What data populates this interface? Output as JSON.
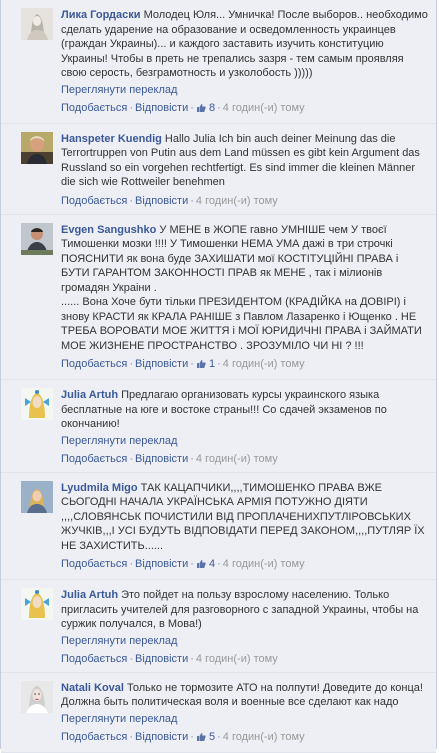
{
  "ui": {
    "translate": "Переглянути переклад",
    "like": "Подобається",
    "reply": "Відповісти",
    "sep": "·"
  },
  "comments": [
    {
      "author": "Лика Гордаски",
      "text": "Молодец Юля... Умничка! После выборов.. необходимо сделать ударение на образование и осведомленность украинцев (граждан Украины)... и каждого заставить изучить конституцию Украины! Чтобы в преть не трепались зазря - тем самым проявляя свою серость, безграмотность и узколобость )))))",
      "translate": "Переглянути переклад",
      "likes": "8",
      "time": "4 годин(-и) тому",
      "avatar": "woman-sketch"
    },
    {
      "author": "Hanspeter Kuendig",
      "text": "Hallo Julia Ich bin auch deiner Meinung das die Terrortruppen von Putin aus dem Land müssen es gibt kein Argument das Russland so ein vorgehen rechtfertigt. Es sind immer die kleinen Männer die sich wie Rottweiler benehmen",
      "translate": "",
      "likes": "",
      "time": "4 годин(-и) тому",
      "avatar": "man-photo"
    },
    {
      "author": "Evgen Sangushko",
      "text": "У МЕНЕ в ЖОПЕ гавно УМНІШЕ чем У твоєї Тимошенки мозки !!!! У Тимошенки НЕМА УМА дажі в три строчкі ПОЯСНИТИ як вона буде ЗАХИШАТИ мої КОСТІТУЦІЙНІ ПРАВА і БУТИ ГАРАНТОМ ЗАКОННОСТІ ПРАВ як МЕНЕ , так і мілионів громадян Украіни .\n...... Вона Хоче бути тільки ПРЕЗИДЕНТОМ (КРАДІЙКА на ДОВІРІ) і знову КРАСТИ як КРАЛА РАНІШЕ з Павлом Лазаренко і Ющенко . НЕ ТРЕБА ВОРОВАТИ МОЕ ЖИТТЯ і МОЇ ЮРИДИЧНІ ПРАВА і ЗАЙМАТИ МОЕ ЖИЗНЕНЕ ПРОСТРАНСТВО . ЗРОЗУМІЛО ЧИ НІ ? !!!",
      "translate": "",
      "likes": "1",
      "time": "4 годин(-и) тому",
      "avatar": "man-photo-2"
    },
    {
      "author": "Julia Artuh",
      "text": "Предлагаю организовать курсы украинского языка бесплатные на юге и востоке страны!!! Со сдачей экзаменов по окончанию!",
      "translate": "Переглянути переклад",
      "likes": "",
      "time": "4 годин(-и) тому",
      "avatar": "woman-drawing"
    },
    {
      "author": "Lyudmila Migo",
      "text": "ТАК КАЦАПЧИКИ,,,,ТИМОШЕНКО ПРАВА ВЖЕ СЬОГОДНІ НАЧАЛА УКРАЇНСЬКА АРМІЯ ПОТУЖНО ДІЯТИ ,,,,СЛОВЯНСЬК ПОЧИСТИЛИ ВІД ПРОПЛАЧЕНИХПУТЛІРОВСЬКИХ ЖУЧКІВ,,,І УСІ БУДУТЬ ВІДПОВІДАТИ ПЕРЕД ЗАКОНОМ,,,,ПУТЛЯР ЇХ НЕ ЗАХИСТИТЬ......",
      "translate": "",
      "likes": "4",
      "time": "4 годин(-и) тому",
      "avatar": "woman-photo"
    },
    {
      "author": "Julia Artuh",
      "text": "Это пойдет на пользу взрослому населению. Только пригласить учителей для разговорного с западной Украины, чтобы на суржик получался, в Мова!)",
      "translate": "Переглянути переклад",
      "likes": "",
      "time": "4 годин(-и) тому",
      "avatar": "woman-drawing"
    },
    {
      "author": "Natali Koval",
      "text": "Только не тормозите АТО на полпути! Доведите до конца! Должна быть политическая воля и военные все сделают как надо",
      "translate": "Переглянути переклад",
      "likes": "5",
      "time": "4 годин(-и) тому",
      "avatar": "woman-portrait"
    }
  ]
}
